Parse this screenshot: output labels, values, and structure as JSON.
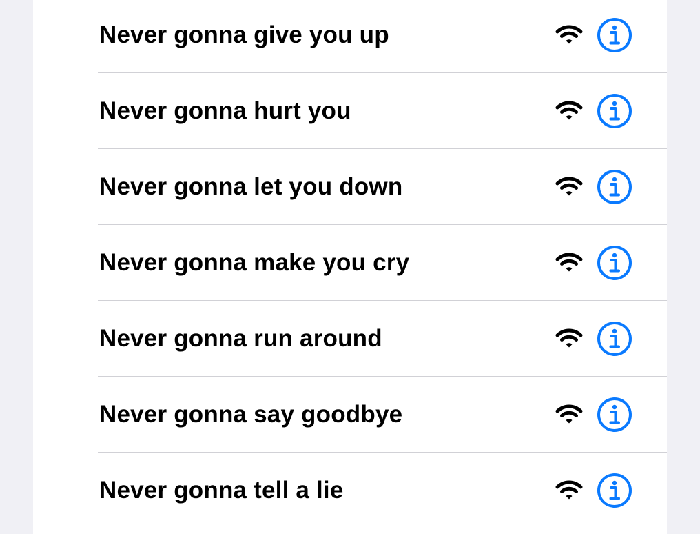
{
  "colors": {
    "background": "#f0f0f5",
    "card": "#ffffff",
    "separator": "#d1d1d6",
    "text": "#000000",
    "accent": "#0a7aff"
  },
  "networks": [
    {
      "name": "Never gonna give you up",
      "signal_icon": "wifi-icon",
      "info_icon": "info-circle-icon"
    },
    {
      "name": "Never gonna hurt you",
      "signal_icon": "wifi-icon",
      "info_icon": "info-circle-icon"
    },
    {
      "name": "Never gonna let you down",
      "signal_icon": "wifi-icon",
      "info_icon": "info-circle-icon"
    },
    {
      "name": "Never gonna make you cry",
      "signal_icon": "wifi-icon",
      "info_icon": "info-circle-icon"
    },
    {
      "name": "Never gonna run around",
      "signal_icon": "wifi-icon",
      "info_icon": "info-circle-icon"
    },
    {
      "name": "Never gonna say goodbye",
      "signal_icon": "wifi-icon",
      "info_icon": "info-circle-icon"
    },
    {
      "name": "Never gonna tell a lie",
      "signal_icon": "wifi-icon",
      "info_icon": "info-circle-icon"
    }
  ]
}
